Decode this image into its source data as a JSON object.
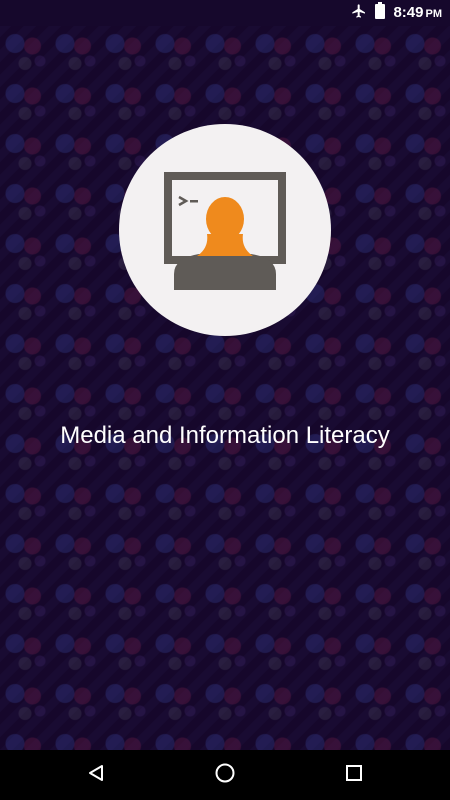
{
  "status_bar": {
    "time": "8:49",
    "ampm": "PM",
    "icons": [
      "airplane-icon",
      "battery-icon"
    ]
  },
  "splash": {
    "title": "Media and Information Literacy",
    "logo_colors": {
      "circle": "#f3f1f2",
      "monitor": "#5f5b57",
      "person": "#ef8a1d"
    }
  },
  "nav_bar": {
    "buttons": [
      "back-icon",
      "home-icon",
      "recents-icon"
    ]
  },
  "colors": {
    "background": "#16082c",
    "text": "#ffffff",
    "nav_bar": "#000000"
  }
}
